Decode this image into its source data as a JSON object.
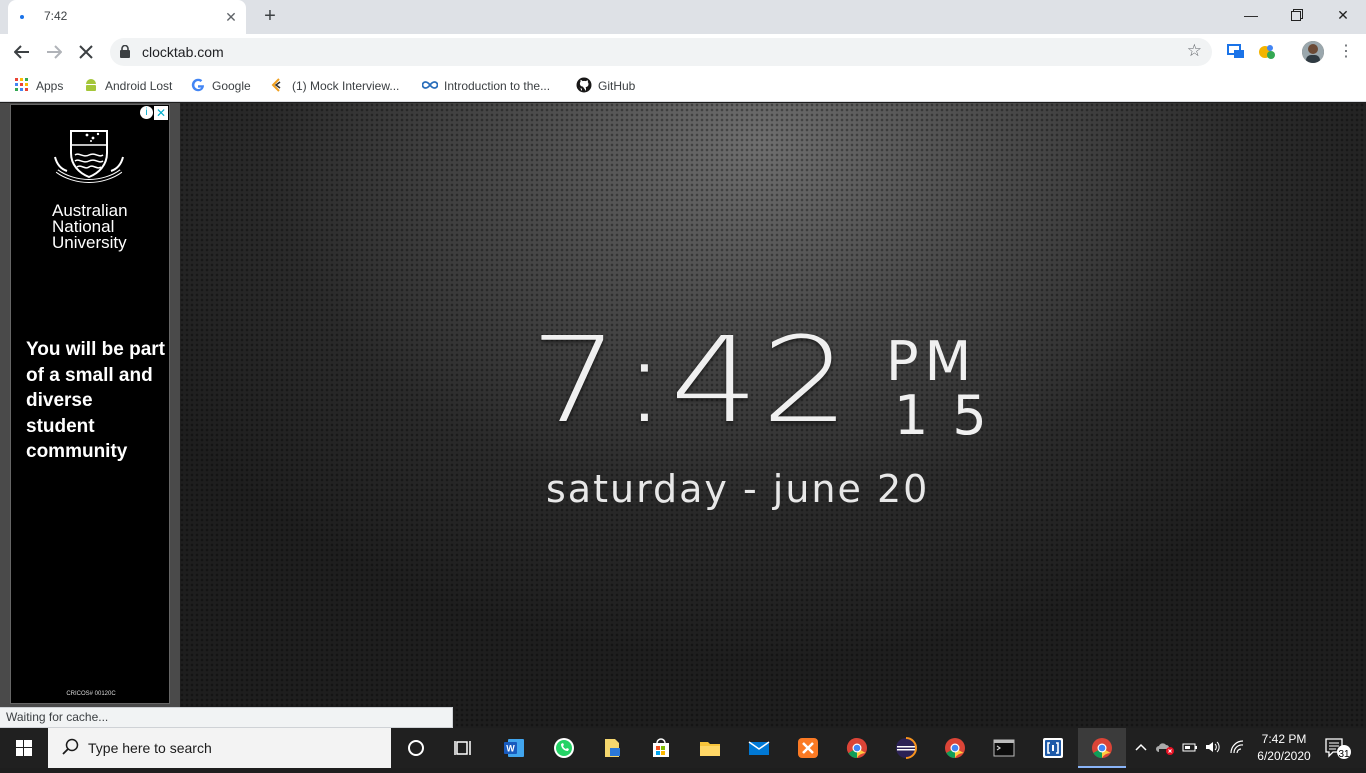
{
  "browser": {
    "tab": {
      "title": "7:42"
    },
    "url": "clocktab.com",
    "bookmarks": [
      {
        "label": "Apps",
        "icon": "apps-grid-icon"
      },
      {
        "label": "Android Lost",
        "icon": "android-icon"
      },
      {
        "label": "Google",
        "icon": "google-icon"
      },
      {
        "label": "(1) Mock Interview...",
        "icon": "link-icon"
      },
      {
        "label": "Introduction to the...",
        "icon": "infinity-icon"
      },
      {
        "label": "GitHub",
        "icon": "github-icon"
      }
    ],
    "status": "Waiting for cache..."
  },
  "ad": {
    "institution": "Australian National University",
    "institution_lines": [
      "Australian",
      "National",
      "University"
    ],
    "headline": "You will be part of a small and diverse student community",
    "cricos": "CRICOS# 00120C"
  },
  "clock": {
    "time": "7:42",
    "ampm": "PM",
    "seconds": "15",
    "date": "saturday - june 20"
  },
  "taskbar": {
    "search_placeholder": "Type here to search",
    "tray_time": "7:42 PM",
    "tray_date": "6/20/2020",
    "notification_count": "31"
  },
  "colors": {
    "tab_strip": "#dee1e6",
    "taskbar": "#202020",
    "accent": "#1a73e8"
  }
}
